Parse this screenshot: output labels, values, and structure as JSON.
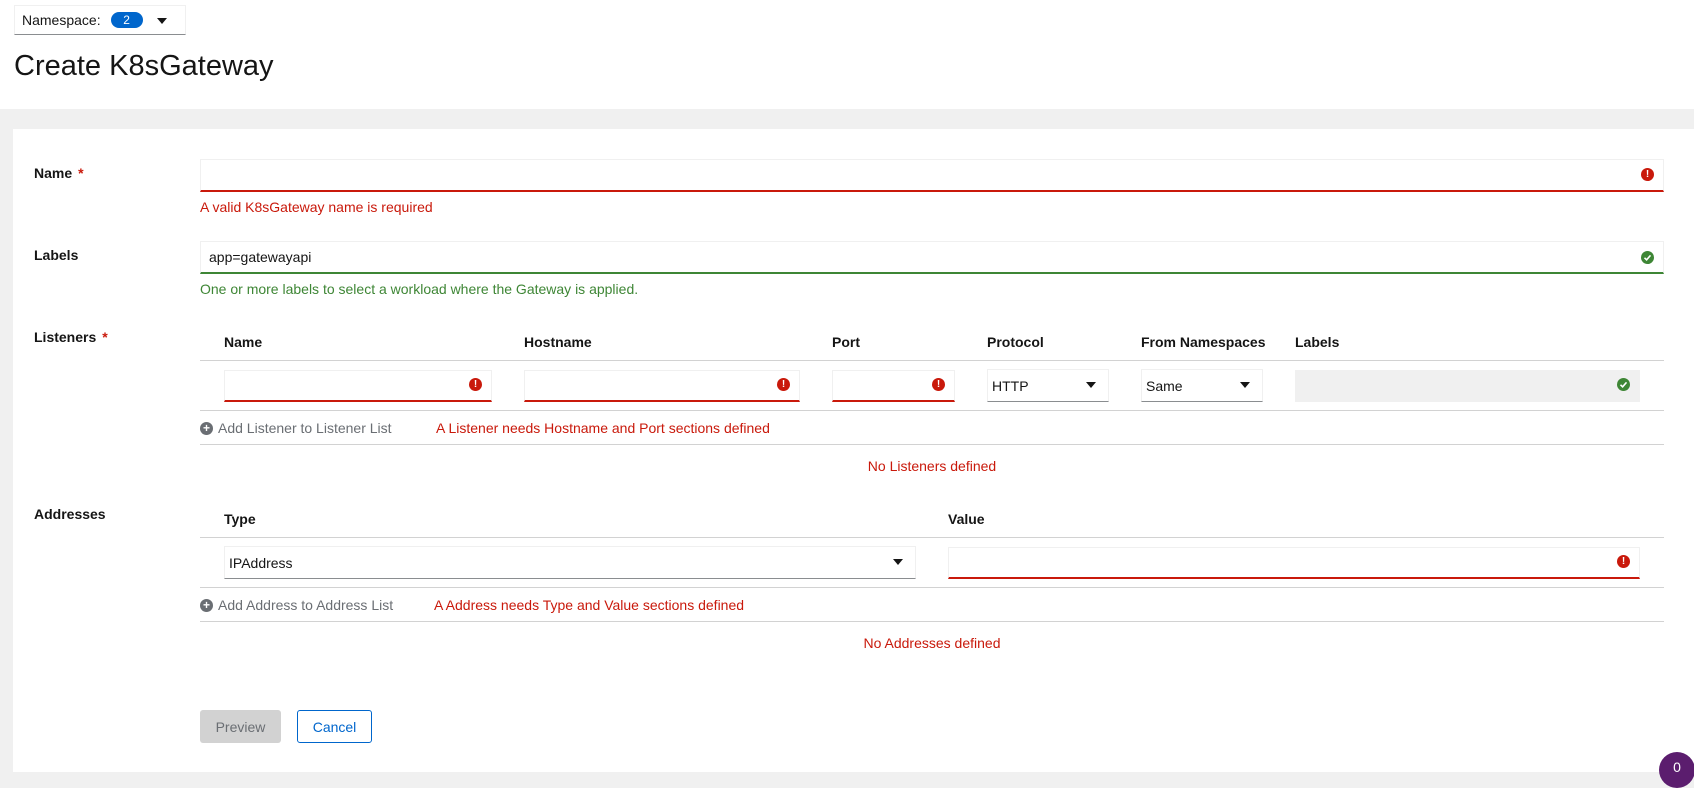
{
  "namespace": {
    "label": "Namespace:",
    "count": "2"
  },
  "page": {
    "title": "Create K8sGateway"
  },
  "form": {
    "name": {
      "label": "Name",
      "required_mark": "*",
      "value": "",
      "error": "A valid K8sGateway name is required"
    },
    "labels": {
      "label": "Labels",
      "value": "app=gatewayapi",
      "helper": "One or more labels to select a workload where the Gateway is applied."
    },
    "listeners": {
      "label": "Listeners",
      "required_mark": "*",
      "columns": [
        "Name",
        "Hostname",
        "Port",
        "Protocol",
        "From Namespaces",
        "Labels"
      ],
      "row": {
        "name": "",
        "hostname": "",
        "port": "",
        "protocol": "HTTP",
        "from_namespaces": "Same",
        "labels": ""
      },
      "add_label": "Add Listener to Listener List",
      "add_error": "A Listener needs Hostname and Port sections defined",
      "empty": "No Listeners defined"
    },
    "addresses": {
      "label": "Addresses",
      "columns": [
        "Type",
        "Value"
      ],
      "row": {
        "type": "IPAddress",
        "value": ""
      },
      "add_label": "Add Address to Address List",
      "add_error": "A Address needs Type and Value sections defined",
      "empty": "No Addresses defined"
    }
  },
  "buttons": {
    "preview": "Preview",
    "cancel": "Cancel"
  },
  "notification_badge": "0",
  "colors": {
    "error": "#c9190b",
    "success": "#3e8635",
    "link": "#0066cc",
    "badge": "#5b1d6e"
  },
  "icons": [
    "caret-down-icon",
    "exclamation-circle-icon",
    "check-circle-icon",
    "plus-circle-icon"
  ]
}
